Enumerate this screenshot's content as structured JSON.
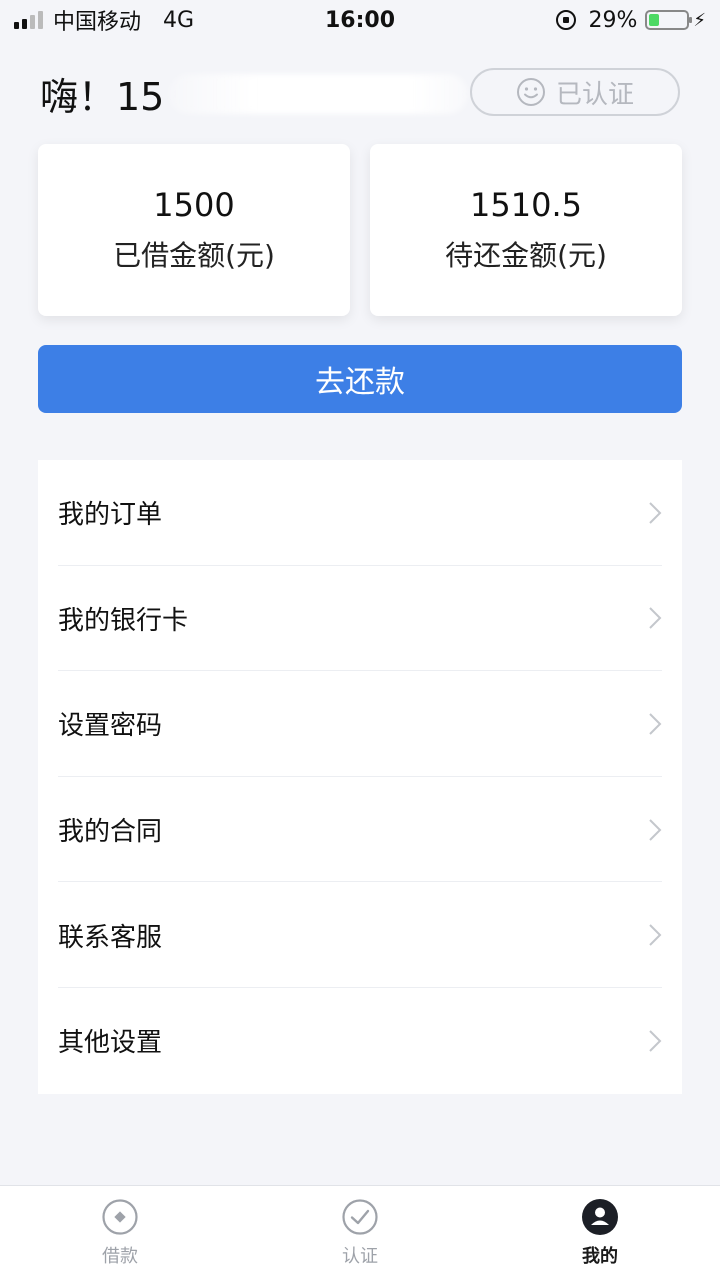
{
  "status_bar": {
    "carrier": "中国移动",
    "network": "4G",
    "time": "16:00",
    "battery_percent": "29%",
    "battery_level": 0.29
  },
  "header": {
    "greeting": "嗨！15",
    "verify_badge": "已认证"
  },
  "summary": {
    "borrowed_value": "1500",
    "borrowed_label": "已借金额(元)",
    "due_value": "1510.5",
    "due_label": "待还金额(元)"
  },
  "repay_button": "去还款",
  "menu": {
    "items": [
      {
        "label": "我的订单"
      },
      {
        "label": "我的银行卡"
      },
      {
        "label": "设置密码"
      },
      {
        "label": "我的合同"
      },
      {
        "label": "联系客服"
      },
      {
        "label": "其他设置"
      }
    ]
  },
  "tabs": [
    {
      "label": "借款",
      "icon": "loan-icon"
    },
    {
      "label": "认证",
      "icon": "check-circle-icon"
    },
    {
      "label": "我的",
      "icon": "user-icon"
    }
  ],
  "colors": {
    "accent": "#3d7fe6",
    "background": "#f4f5f9",
    "battery": "#4cd964"
  }
}
